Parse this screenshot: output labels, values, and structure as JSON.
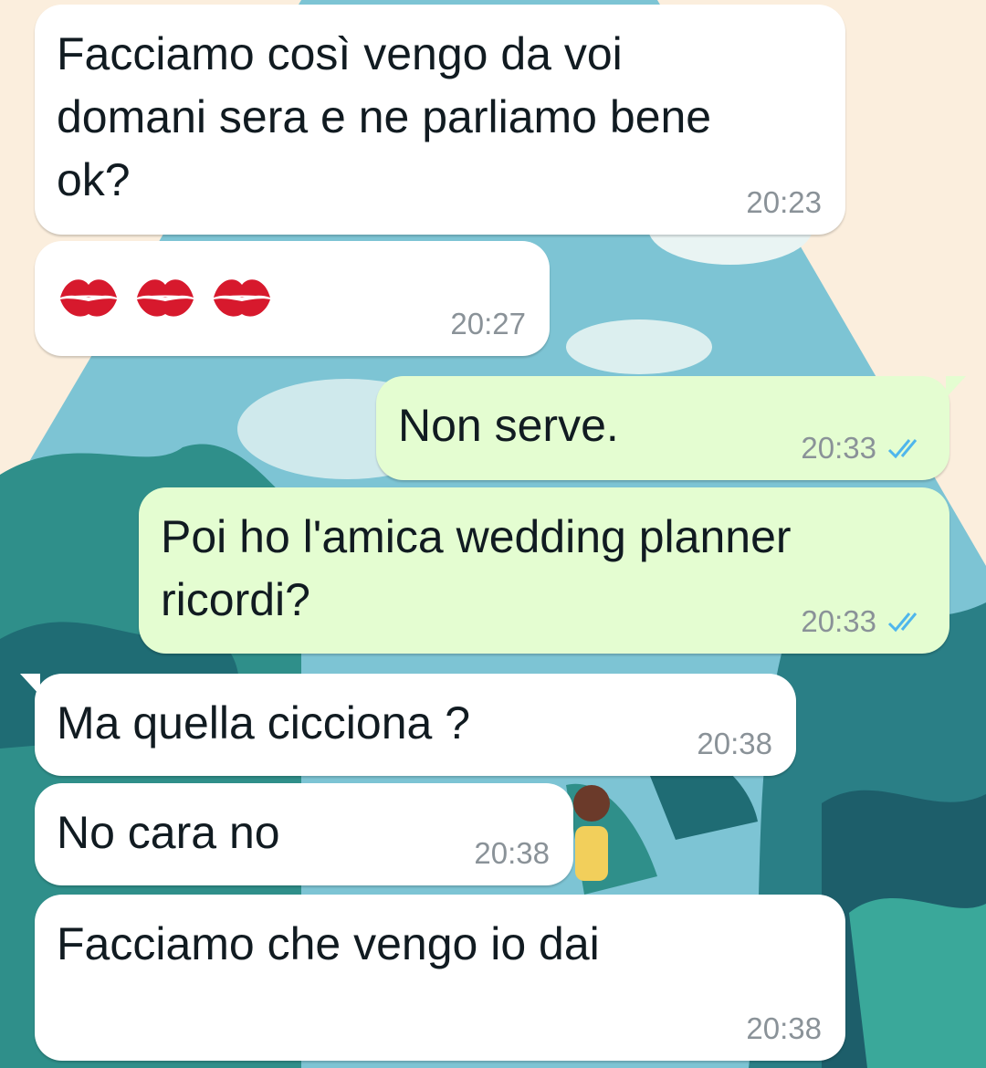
{
  "chat": {
    "messages": [
      {
        "direction": "in",
        "text": "Facciamo così vengo da voi\ndomani sera e ne parliamo bene\nok?",
        "time": "20:23"
      },
      {
        "direction": "in",
        "text": "💋💋💋",
        "time": "20:27",
        "emoji": "kiss-mark-icon"
      },
      {
        "direction": "out",
        "text": "Non serve.",
        "time": "20:33",
        "status": "read"
      },
      {
        "direction": "out",
        "text": "Poi ho l'amica wedding planner\nricordi?",
        "time": "20:33",
        "status": "read"
      },
      {
        "direction": "in",
        "text": "Ma quella cicciona ?",
        "time": "20:38"
      },
      {
        "direction": "in",
        "text": "No cara no",
        "time": "20:38"
      },
      {
        "direction": "in",
        "text": "Facciamo che vengo io dai",
        "time": "20:38"
      }
    ]
  },
  "colors": {
    "incoming_bubble": "#ffffff",
    "outgoing_bubble": "#e4fdd1",
    "timestamp": "#8a9298",
    "read_ticks": "#4fb6ec",
    "kiss": "#d7192d"
  }
}
